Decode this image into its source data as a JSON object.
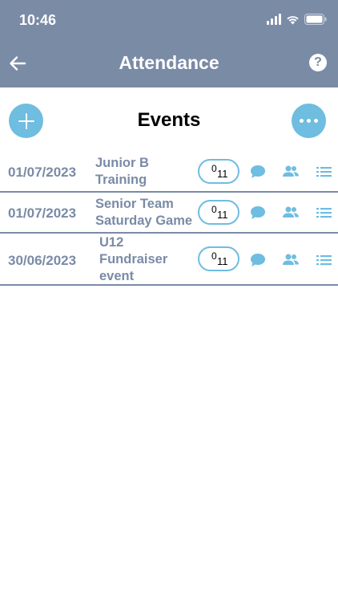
{
  "status_bar": {
    "time": "10:46"
  },
  "nav": {
    "title": "Attendance",
    "help_label": "?"
  },
  "page": {
    "title": "Events"
  },
  "colors": {
    "header": "#7a8ba6",
    "accent": "#6fbde0",
    "text_muted": "#7a8ba6"
  },
  "icons": {
    "back": "arrow-left-icon",
    "help": "question-circle-icon",
    "add": "plus-icon",
    "more": "more-horizontal-icon",
    "comment": "comment-icon",
    "users": "users-icon",
    "list": "list-icon"
  },
  "events": [
    {
      "date": "01/07/2023",
      "name_lines": [
        "Junior B",
        "Training"
      ],
      "count_top": "0",
      "count_bottom": "11"
    },
    {
      "date": "01/07/2023",
      "name_lines": [
        "Senior Team",
        "Saturday Game"
      ],
      "count_top": "0",
      "count_bottom": "11"
    },
    {
      "date": "30/06/2023",
      "name_lines": [
        "U12",
        "Fundraiser",
        "event"
      ],
      "count_top": "0",
      "count_bottom": "11"
    }
  ]
}
